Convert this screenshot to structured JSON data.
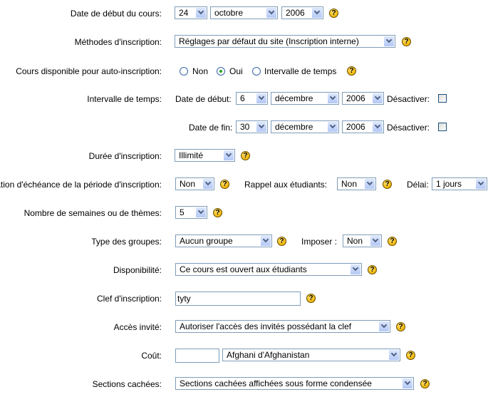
{
  "fields": {
    "date_debut": {
      "label": "Date de début du cours:",
      "day": "24",
      "month": "octobre",
      "year": "2006"
    },
    "methodes": {
      "label": "Méthodes d'inscription:",
      "value": "Réglages par défaut du site (Inscription interne)"
    },
    "auto_inscription": {
      "label": "Cours disponible pour auto-inscription:",
      "options": [
        "Non",
        "Oui",
        "Intervalle de temps"
      ],
      "selected": "Oui"
    },
    "intervalle": {
      "label": "Intervalle de temps:",
      "start_label": "Date de début:",
      "start_day": "6",
      "start_month": "décembre",
      "start_year": "2006",
      "start_disable_label": "Désactiver:",
      "end_label": "Date de fin:",
      "end_day": "30",
      "end_month": "décembre",
      "end_year": "2006",
      "end_disable_label": "Désactiver:"
    },
    "duree": {
      "label": "Durée d'inscription:",
      "value": "Illimité"
    },
    "echeance": {
      "label": "Notification d'échéance de la période d'inscription:",
      "value": "Non",
      "rappel_label": "Rappel aux étudiants:",
      "rappel_value": "Non",
      "delai_label": "Délai:",
      "delai_value": "1 jours"
    },
    "semaines": {
      "label": "Nombre de semaines ou de thèmes:",
      "value": "5"
    },
    "groupes": {
      "label": "Type des groupes:",
      "value": "Aucun groupe",
      "imposer_label": "Imposer :",
      "imposer_value": "Non"
    },
    "disponibilite": {
      "label": "Disponibilité:",
      "value": "Ce cours est ouvert aux étudiants"
    },
    "clef": {
      "label": "Clef d'inscription:",
      "value": "tyty"
    },
    "acces_invite": {
      "label": "Accès invité:",
      "value": "Autoriser l'accès des invités possédant la clef"
    },
    "cout": {
      "label": "Coût:",
      "amount": "",
      "currency": "Afghani d'Afghanistan"
    },
    "sections_cachees": {
      "label": "Sections cachées:",
      "value": "Sections cachées affichées sous forme condensée"
    }
  },
  "help_glyph": "?",
  "colors": {
    "select_border": "#7f9db9",
    "help_icon": "#f0b400",
    "radio_selected": "#27a327"
  }
}
